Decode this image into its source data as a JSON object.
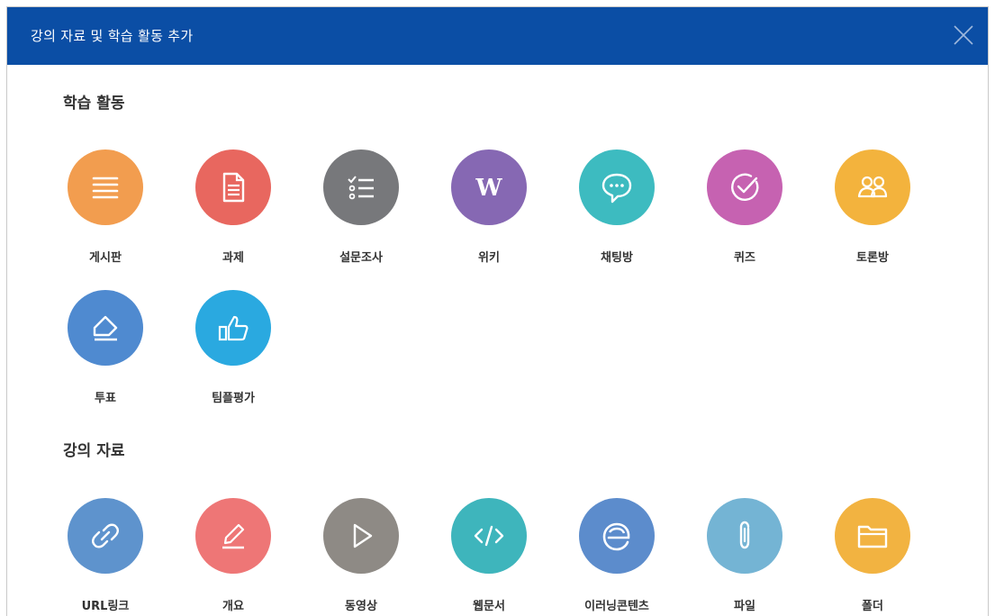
{
  "dialog": {
    "title": "강의 자료 및 학습 활동 추가"
  },
  "sections": {
    "activities": {
      "title": "학습 활동",
      "items": [
        {
          "label": "게시판",
          "icon": "list-icon",
          "color": "#f29d4f"
        },
        {
          "label": "과제",
          "icon": "document-icon",
          "color": "#e8675f"
        },
        {
          "label": "설문조사",
          "icon": "checklist-icon",
          "color": "#77787b"
        },
        {
          "label": "위키",
          "icon": "wiki-w-icon",
          "color": "#8668b3"
        },
        {
          "label": "채팅방",
          "icon": "chat-bubble-icon",
          "color": "#3dbbc0"
        },
        {
          "label": "퀴즈",
          "icon": "check-circle-icon",
          "color": "#c662b1"
        },
        {
          "label": "토론방",
          "icon": "people-icon",
          "color": "#f3b33d"
        },
        {
          "label": "투표",
          "icon": "eraser-icon",
          "color": "#4f8ad0"
        },
        {
          "label": "팀플평가",
          "icon": "thumbs-up-icon",
          "color": "#2aa9e0"
        }
      ]
    },
    "materials": {
      "title": "강의 자료",
      "items": [
        {
          "label": "URL링크",
          "icon": "link-icon",
          "color": "#5e93cd"
        },
        {
          "label": "개요",
          "icon": "pencil-icon",
          "color": "#ee7676"
        },
        {
          "label": "동영상",
          "icon": "play-icon",
          "color": "#8e8a85"
        },
        {
          "label": "웹문서",
          "icon": "code-icon",
          "color": "#3eb5bc"
        },
        {
          "label": "이러닝콘텐츠",
          "icon": "ie-e-icon",
          "color": "#5c8ccc"
        },
        {
          "label": "파일",
          "icon": "paperclip-icon",
          "color": "#74b4d4"
        },
        {
          "label": "폴더",
          "icon": "folder-icon",
          "color": "#f2b341"
        }
      ]
    }
  }
}
